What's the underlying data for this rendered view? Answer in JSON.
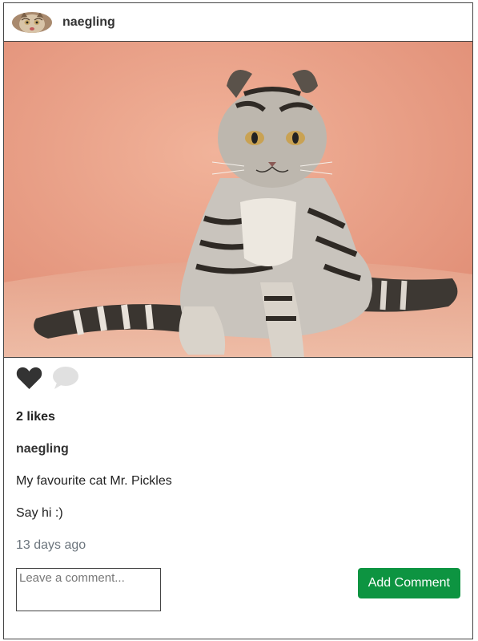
{
  "post": {
    "username": "naegling",
    "likes_text": "2 likes",
    "caption_username": "naegling",
    "caption_lines": [
      "My favourite cat Mr. Pickles",
      "Say hi :)"
    ],
    "timestamp": "13 days ago"
  },
  "comment": {
    "placeholder": "Leave a comment...",
    "button_label": "Add Comment"
  },
  "icons": {
    "like": "heart-icon",
    "comment": "speech-bubble-icon"
  },
  "colors": {
    "button": "#0d9441",
    "timestamp": "#6c757d",
    "heart": "#333333",
    "comment_icon": "#e0e0e0",
    "photo_background": "#e89a80"
  }
}
